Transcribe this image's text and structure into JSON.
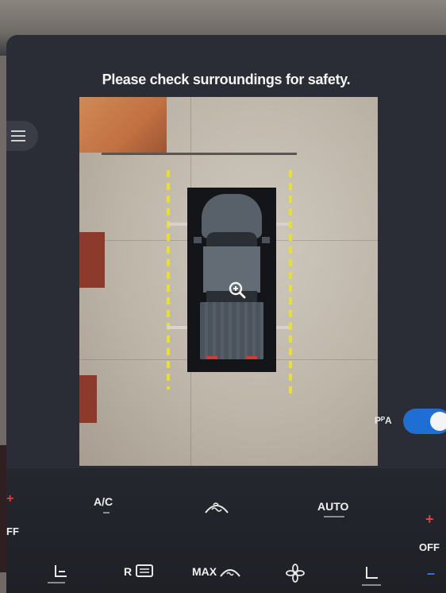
{
  "camera": {
    "message": "Please check surroundings for safety.",
    "zoom_icon": "zoom-in-icon"
  },
  "park_assist": {
    "label": "PᴾA",
    "toggle_on": true,
    "toggle_color": "#1f6ed4"
  },
  "climate": {
    "ac_label": "A/C",
    "auto_label": "AUTO",
    "off_left_label": "FF",
    "off_right_label": "OFF",
    "rear_defrost_label": "R",
    "max_defrost_label": "MAX",
    "plus_symbol": "+"
  },
  "icons": {
    "menu": "menu-icon",
    "defrost": "windshield-airflow-icon",
    "seat_left": "heated-seat-icon",
    "fan": "fan-icon",
    "seat_right": "seat-icon"
  }
}
